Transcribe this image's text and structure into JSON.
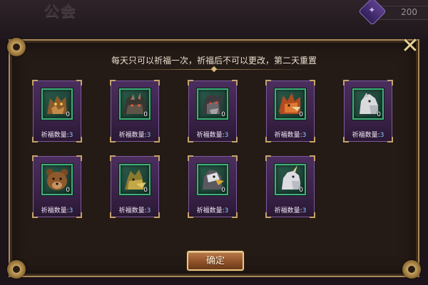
{
  "header": {
    "title": "公会",
    "currency_value": "200",
    "currency_icon": "guild-token-icon"
  },
  "panel": {
    "notice": "每天只可以祈福一次，祈福后不可以更改，第二天重置",
    "close_icon": "close-icon",
    "confirm_label": "确定"
  },
  "cards": [
    {
      "creature": "wolf",
      "count": "0",
      "label": "祈福数量:",
      "quantity": "3"
    },
    {
      "creature": "dragon",
      "count": "0",
      "label": "祈福数量:",
      "quantity": "3"
    },
    {
      "creature": "wyvern",
      "count": "0",
      "label": "祈福数量:",
      "quantity": "3"
    },
    {
      "creature": "phoenix",
      "count": "0",
      "label": "祈福数量:",
      "quantity": "3"
    },
    {
      "creature": "horse",
      "count": "0",
      "label": "祈福数量:",
      "quantity": "3"
    },
    {
      "creature": "bear",
      "count": "0",
      "label": "祈福数量:",
      "quantity": "3"
    },
    {
      "creature": "drake",
      "count": "0",
      "label": "祈福数量:",
      "quantity": "3"
    },
    {
      "creature": "griffin",
      "count": "0",
      "label": "祈福数量:",
      "quantity": "3"
    },
    {
      "creature": "unicorn",
      "count": "0",
      "label": "祈福数量:",
      "quantity": "3"
    }
  ],
  "colors": {
    "card_bg": "#3a2248",
    "slot_border": "#3fae7c",
    "gold_trim": "#c4a46a",
    "quantity_color": "#7fd1ff"
  }
}
